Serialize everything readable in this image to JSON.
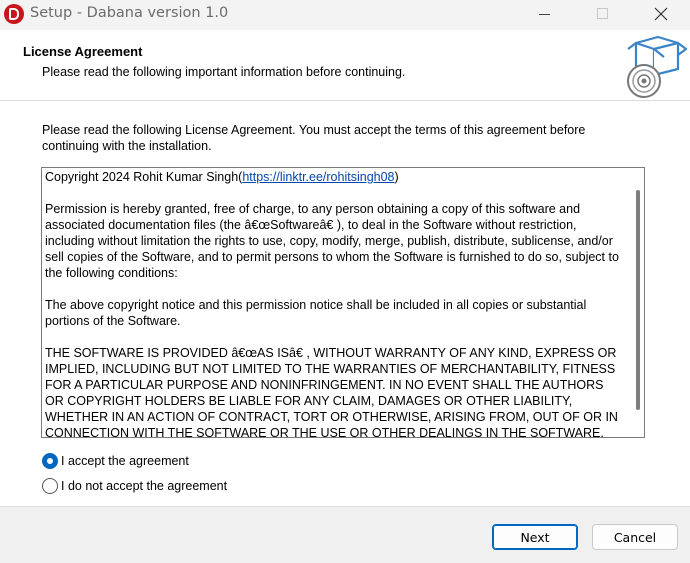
{
  "window": {
    "title": "Setup - Dabana version 1.0",
    "close_glyph": "✕"
  },
  "header": {
    "title": "License Agreement",
    "subtitle": "Please read the following important information before continuing."
  },
  "body": {
    "intro": "Please read the following License Agreement. You must accept the terms of this agreement before continuing with the installation."
  },
  "license": {
    "copyright_prefix": "Copyright 2024 Rohit Kumar Singh(",
    "copyright_link": "https://linktr.ee/rohitsingh08",
    "copyright_suffix": ")",
    "para1": "Permission is hereby granted, free of charge, to any person obtaining a copy of this software and associated documentation files (the â€œSoftwareâ€ ), to deal in the Software without restriction, including without limitation the rights to use, copy, modify, merge, publish, distribute, sublicense, and/or sell copies of the Software, and to permit persons to whom the Software is furnished to do so, subject to the following conditions:",
    "para2": "The above copyright notice and this permission notice shall be included in all copies or substantial portions of the Software.",
    "para3": "THE SOFTWARE IS PROVIDED â€œAS ISâ€ , WITHOUT WARRANTY OF ANY KIND, EXPRESS OR IMPLIED, INCLUDING BUT NOT LIMITED TO THE WARRANTIES OF MERCHANTABILITY, FITNESS FOR A PARTICULAR PURPOSE AND NONINFRINGEMENT. IN NO EVENT SHALL THE AUTHORS OR COPYRIGHT HOLDERS BE LIABLE FOR ANY CLAIM, DAMAGES OR OTHER LIABILITY, WHETHER IN AN ACTION OF CONTRACT, TORT OR OTHERWISE, ARISING FROM, OUT OF OR IN CONNECTION WITH THE SOFTWARE OR THE USE OR OTHER DEALINGS IN THE SOFTWARE."
  },
  "options": {
    "accept_label": "I accept the agreement",
    "decline_label": "I do not accept the agreement",
    "selected": "accept"
  },
  "buttons": {
    "next": "Next",
    "cancel": "Cancel"
  },
  "colors": {
    "accent": "#0067c0",
    "app_icon": "#c4161c",
    "link": "#0645ad"
  },
  "icons": {
    "app": "dabana-logo-icon",
    "header": "setup-box-disc-icon"
  }
}
